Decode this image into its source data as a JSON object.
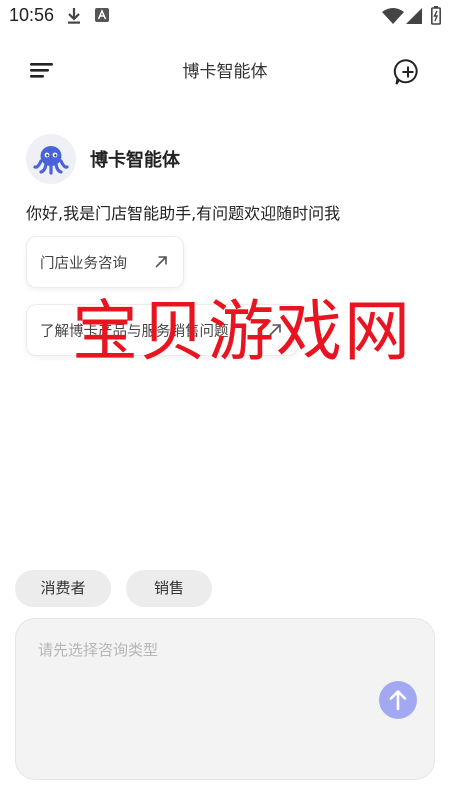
{
  "status_bar": {
    "time": "10:56",
    "icons": [
      "download-icon",
      "a-badge-icon",
      "wifi-icon",
      "signal-icon",
      "battery-icon"
    ]
  },
  "header": {
    "title": "博卡智能体",
    "menu_icon": "menu-icon",
    "new_chat_icon": "add-chat-icon"
  },
  "agent": {
    "name": "博卡智能体",
    "avatar_icon": "octopus-icon",
    "greeting": "你好,我是门店智能助手,有问题欢迎随时问我"
  },
  "suggestions": [
    {
      "label": "门店业务咨询",
      "icon": "arrow-up-right-icon"
    },
    {
      "label": "了解博卡产品与服务销售问题",
      "icon": "arrow-up-right-icon"
    }
  ],
  "watermark": "宝贝游戏网",
  "chips": [
    "消费者",
    "销售"
  ],
  "input": {
    "placeholder": "请先选择咨询类型",
    "send_icon": "arrow-up-icon"
  },
  "colors": {
    "accent_send": "#a3a8f3",
    "avatar_octopus": "#4a63d8",
    "watermark": "#e8141f",
    "chip_bg": "#ececec",
    "input_bg": "#f3f3f3"
  }
}
